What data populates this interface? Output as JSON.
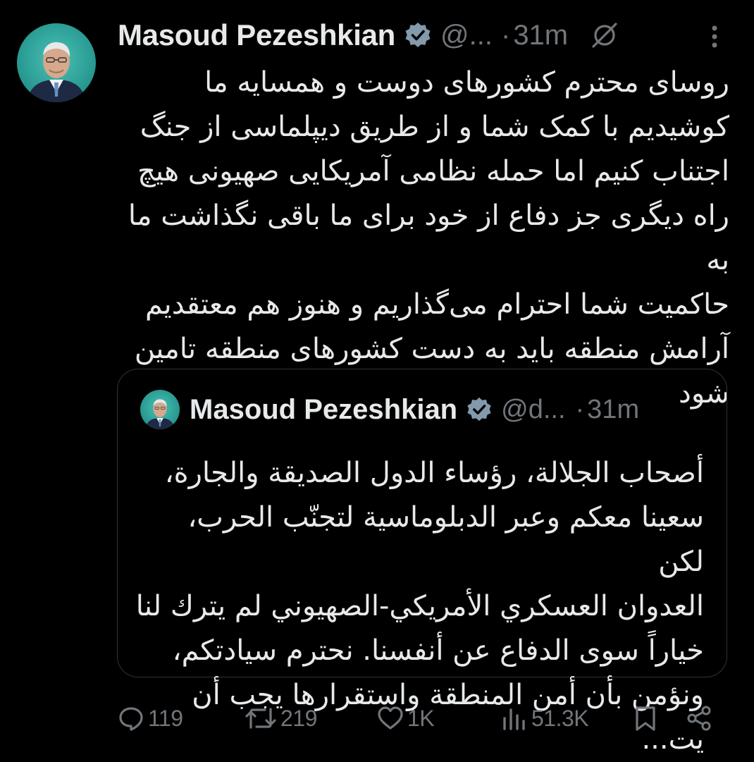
{
  "tweet": {
    "author_name": "Masoud Pezeshkian",
    "handle": "@...",
    "separator": "·",
    "time": "31m",
    "text": "روسای محترم کشورهای دوست و همسایه ما\nکوشیدیم با کمک شما و از طریق دیپلماسی از جنگ\nاجتناب کنیم اما حمله نظامی آمریکایی صهیونی هیچ\nراه دیگری جز دفاع از خود برای ما باقی نگذاشت ما به\nحاکمیت شما احترام می‌گذاریم و هنوز هم معتقدیم\nآرامش منطقه باید به دست کشورهای منطقه تامین\nشود"
  },
  "quoted_tweet": {
    "author_name": "Masoud Pezeshkian",
    "handle": "@d...",
    "separator": "·",
    "time": "31m",
    "text": "أصحاب الجلالة، رؤساء الدول الصديقة والجارة،\nسعينا معكم وعبر الدبلوماسية لتجنّب الحرب، لكن\nالعدوان العسكري الأمريكي-الصهيوني لم يترك لنا\nخياراً سوى الدفاع عن أنفسنا. نحترم سيادتكم،\nونؤمن بأن أمن المنطقة واستقرارها يجب أن يت..."
  },
  "actions": {
    "replies": "119",
    "retweets": "219",
    "likes": "1K",
    "views": "51.3K"
  },
  "icons": {
    "verified": "verified-badge-icon",
    "grok": "grok-icon",
    "more": "more-options-icon",
    "reply": "reply-icon",
    "retweet": "retweet-icon",
    "like": "heart-icon",
    "views": "views-icon",
    "bookmark": "bookmark-icon",
    "share": "share-icon"
  },
  "colors": {
    "background": "#000000",
    "text": "#e7e9ea",
    "secondary": "#71767b",
    "border": "#2f3336",
    "verified_badge": "#829aab"
  }
}
